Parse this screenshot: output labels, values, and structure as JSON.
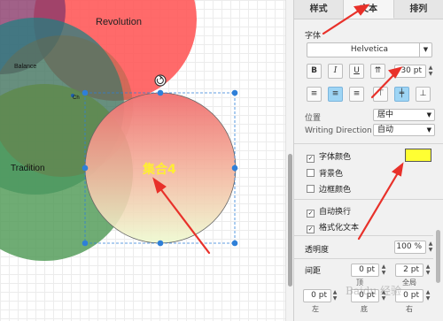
{
  "diagram": {
    "circles": [
      {
        "label": "Revolution"
      },
      {
        "label": "Balance"
      },
      {
        "label": "Tradition"
      },
      {
        "label": "集合4"
      }
    ],
    "small_label": "Ch"
  },
  "panel": {
    "tabs": [
      {
        "label": "样式"
      },
      {
        "label": "文本"
      },
      {
        "label": "排列"
      }
    ],
    "font_section_label": "字体",
    "font_family": "Helvetica",
    "style_buttons": {
      "bold": "B",
      "italic": "I",
      "underline": "U",
      "vertical": "⇈"
    },
    "font_size": "30 pt",
    "position_label": "位置",
    "position_value": "居中",
    "writing_direction_label": "Writing Direction",
    "writing_direction_value": "自动",
    "font_color_label": "字体颜色",
    "font_color_value": "#ffff33",
    "background_color_label": "背景色",
    "border_color_label": "边框颜色",
    "auto_wrap_label": "自动换行",
    "formatted_text_label": "格式化文本",
    "opacity_label": "透明度",
    "opacity_value": "100 %",
    "spacing_label": "间距",
    "spacing_top": "0 pt",
    "spacing_global": "2 pt",
    "spacing_top_caption": "顶",
    "spacing_global_caption": "全局",
    "spacing_left": "0 pt",
    "spacing_bottom": "0 pt",
    "spacing_right": "0 pt",
    "spacing_left_caption": "左",
    "spacing_bottom_caption": "底",
    "spacing_right_caption": "右"
  },
  "watermark": "Baidu 经验",
  "colors": {
    "revolution": "#ff6666",
    "balance_teal": "#2a8f8f",
    "tradition": "#4a9a5a",
    "selection_handle": "#2e7fd8",
    "annotation_arrow": "#e8312a",
    "selected_fill_top": "#f08080",
    "selected_fill_bottom": "#eaf8cc"
  }
}
